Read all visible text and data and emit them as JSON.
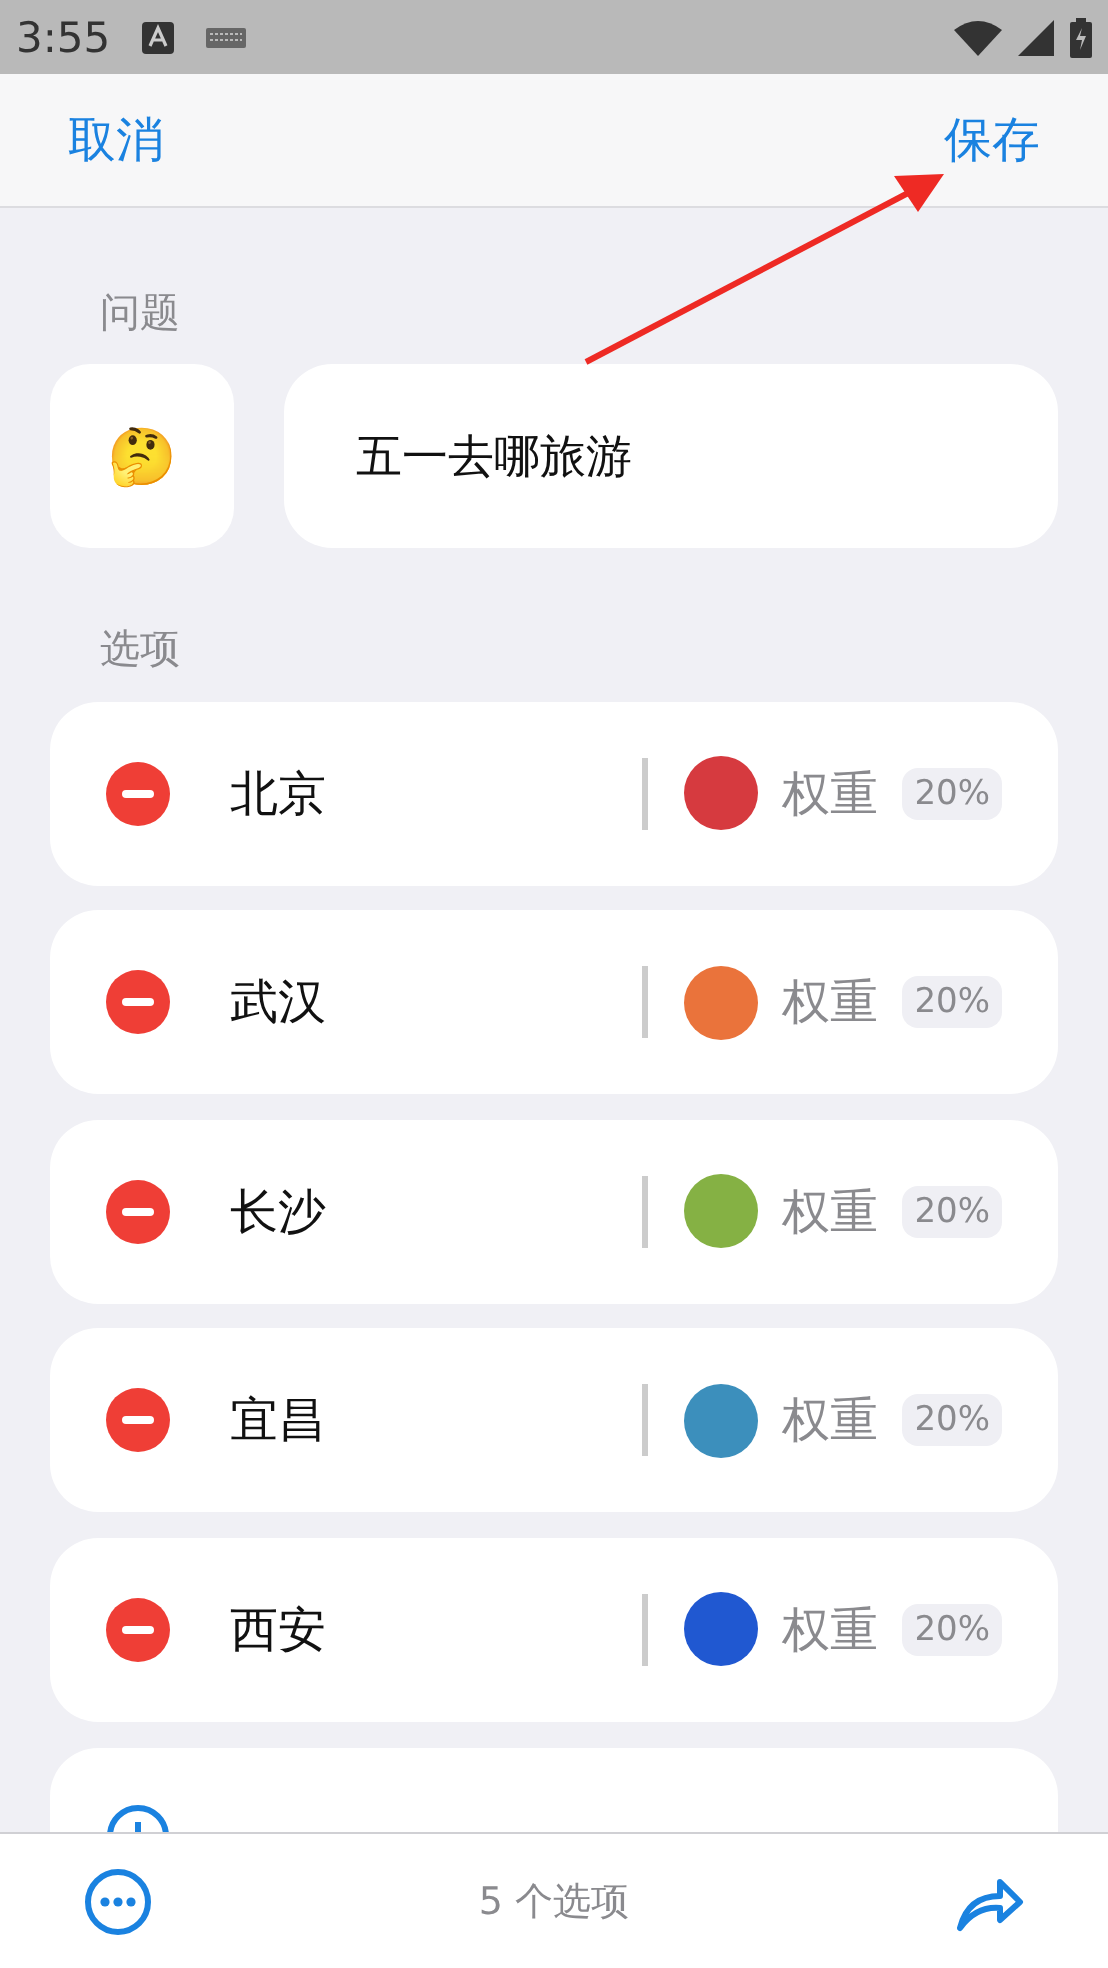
{
  "status_bar": {
    "time": "3:55"
  },
  "header": {
    "cancel": "取消",
    "save": "保存"
  },
  "question": {
    "label": "问题",
    "emoji": "🤔",
    "value": "五一去哪旅游"
  },
  "options": {
    "label": "选项",
    "items": [
      {
        "name": "北京",
        "color": "#d63a3f",
        "weight_label": "权重",
        "weight": "20%"
      },
      {
        "name": "武汉",
        "color": "#ea733b",
        "weight_label": "权重",
        "weight": "20%"
      },
      {
        "name": "长沙",
        "color": "#85b144",
        "weight_label": "权重",
        "weight": "20%"
      },
      {
        "name": "宜昌",
        "color": "#3c8fbc",
        "weight_label": "权重",
        "weight": "20%"
      },
      {
        "name": "西安",
        "color": "#2058d1",
        "weight_label": "权重",
        "weight": "20%"
      }
    ]
  },
  "footer": {
    "count": "5 个选项"
  }
}
